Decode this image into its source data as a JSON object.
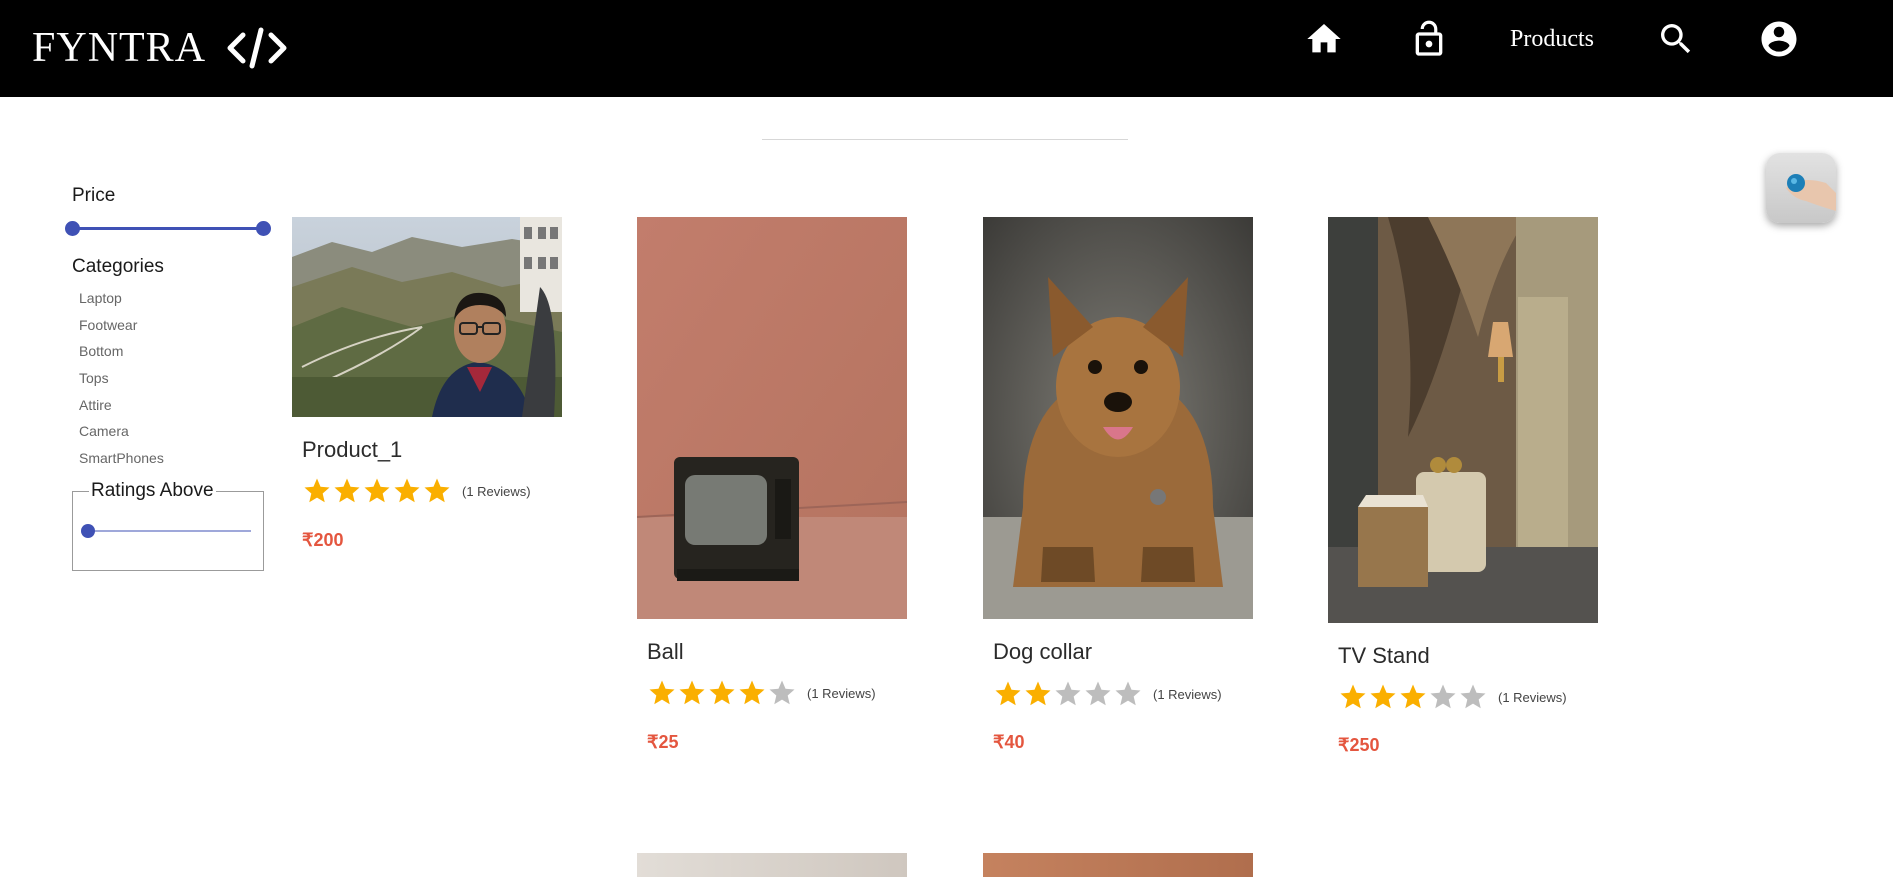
{
  "header": {
    "brand": "FYNTRA",
    "nav": {
      "home_icon": "home-icon",
      "lock_icon": "lock-open-icon",
      "products_label": "Products",
      "search_icon": "search-icon",
      "account_icon": "account-circle-icon"
    }
  },
  "filters": {
    "price_label": "Price",
    "categories_label": "Categories",
    "categories": [
      "Laptop",
      "Footwear",
      "Bottom",
      "Tops",
      "Attire",
      "Camera",
      "SmartPhones"
    ],
    "ratings_label": "Ratings Above",
    "ratings_value": 0
  },
  "products": [
    {
      "name": "Product_1",
      "rating": 5,
      "reviews": "(1 Reviews)",
      "price": "₹200",
      "image": "photo-person-mountain-valley"
    },
    {
      "name": "Ball",
      "rating": 4,
      "reviews": "(1 Reviews)",
      "price": "₹25",
      "image": "photo-old-tv-pink-wall"
    },
    {
      "name": "Dog collar",
      "rating": 2,
      "reviews": "(1 Reviews)",
      "price": "₹40",
      "image": "photo-terrier-dog"
    },
    {
      "name": "TV Stand",
      "rating": 3,
      "reviews": "(1 Reviews)",
      "price": "₹250",
      "image": "photo-bedroom-interior"
    }
  ],
  "colors": {
    "accent": "#3f51b5",
    "star_filled": "#faaf00",
    "star_empty": "#bdbdbd",
    "price": "#e4563f",
    "header_bg": "#000000"
  }
}
